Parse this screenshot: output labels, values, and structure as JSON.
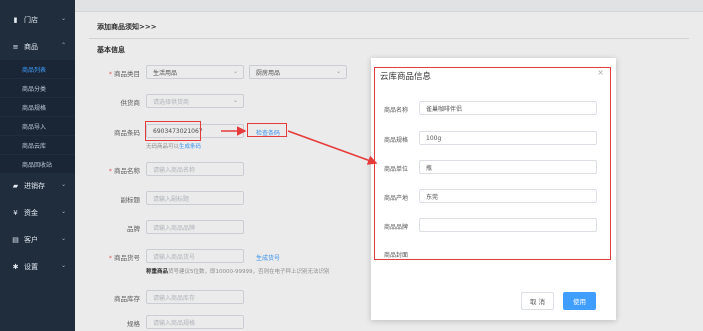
{
  "sidebar": {
    "groups": [
      {
        "label": "门店",
        "icon": "store-icon"
      },
      {
        "label": "商品",
        "icon": "list-icon"
      },
      {
        "label": "进销存",
        "icon": "truck-icon"
      },
      {
        "label": "资金",
        "icon": "yen-icon"
      },
      {
        "label": "客户",
        "icon": "customer-card-icon"
      },
      {
        "label": "设置",
        "icon": "gear-icon"
      }
    ],
    "subitems": [
      "商品列表",
      "商品分类",
      "商品规格",
      "商品导入",
      "商品云库",
      "商品回收站"
    ]
  },
  "main": {
    "notice": "添加商品须知>>>",
    "section": "基本信息",
    "form": {
      "category_label": "商品类目",
      "category_value1": "生活用品",
      "category_value2": "厨房用品",
      "supplier_label": "供货商",
      "supplier_placeholder": "请选择供货商",
      "barcode_label": "商品条码",
      "barcode_value": "6903473021067",
      "barcode_link": "检查条码",
      "barcode_hint_prefix": "无码商品可以",
      "barcode_hint_link": "生成条码",
      "name_label": "商品名称",
      "name_placeholder": "请输入商品名称",
      "alias_label": "副标题",
      "alias_placeholder": "请输入副标题",
      "brand_label": "品牌",
      "brand_placeholder": "请输入商品品牌",
      "sku_label": "商品货号",
      "sku_placeholder": "请输入商品货号",
      "sku_link": "生成货号",
      "sku_hint_bold": "称重商品",
      "sku_hint_text": "货号建议5位数，即10000-99999，否则在电子秤上识别无法识别",
      "stock_label": "商品库存",
      "stock_placeholder": "请输入商品库存",
      "spec_label": "规格",
      "spec_placeholder": "请输入商品规格"
    }
  },
  "modal": {
    "title": "云库商品信息",
    "close": "×",
    "fields": [
      {
        "label": "商品名称",
        "value": "雀巢咖啡伴侣"
      },
      {
        "label": "商品规格",
        "value": "100g"
      },
      {
        "label": "商品单位",
        "value": "瓶"
      },
      {
        "label": "商品产地",
        "value": "东莞"
      },
      {
        "label": "商品品牌",
        "value": ""
      }
    ],
    "image_label": "商品封面",
    "cancel": "取 消",
    "use": "使用"
  },
  "colors": {
    "sidebar_bg": "#1f2d3d",
    "primary": "#409eff",
    "annotation_red": "#e63b3b"
  }
}
